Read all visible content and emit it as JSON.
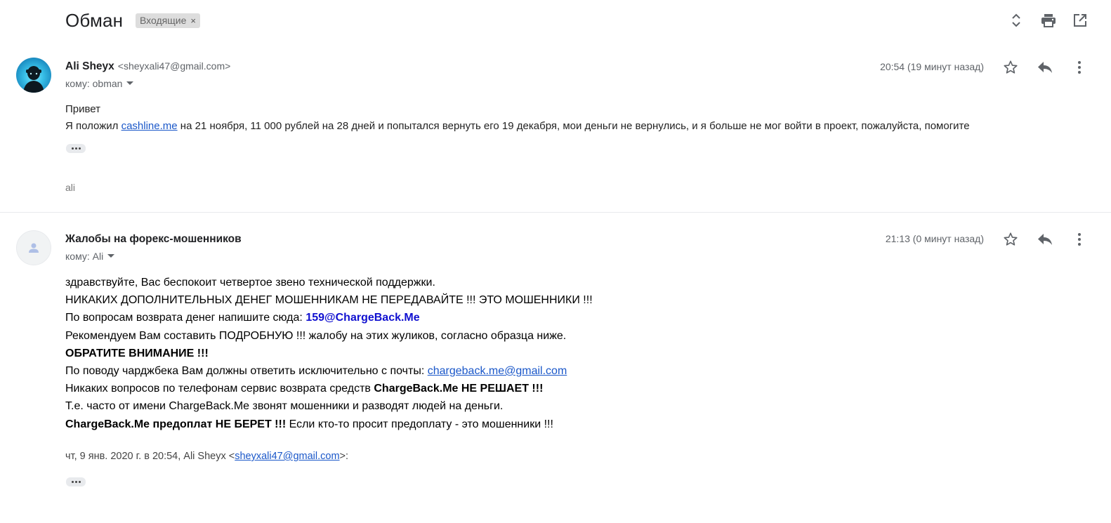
{
  "thread": {
    "subject": "Обман",
    "label": "Входящие",
    "label_remove": "×"
  },
  "toolbar_icons": [
    "expand-collapse-icon",
    "print-icon",
    "open-new-window-icon"
  ],
  "messages": [
    {
      "sender_name": "Ali Sheyx",
      "sender_email": "<sheyxali47@gmail.com>",
      "to": "кому: obman",
      "time": "20:54 (19 минут назад)",
      "greeting": "Привет",
      "text_before_link": "Я положил ",
      "link_text": "cashline.me",
      "text_after_link": " на 21 ноября, 11 000 рублей на 28 дней и попытался вернуть его 19 декабря, мои деньги не вернулись, и я больше не мог войти в проект, пожалуйста, помогите",
      "signature": "ali"
    },
    {
      "sender_name": "Жалобы на форекс-мошенников",
      "to": "кому: Ali",
      "time": "21:13 (0 минут назад)",
      "lines": {
        "l1": "здравствуйте, Вас беспокоит четвертое звено технической поддержки.",
        "l2": "НИКАКИХ ДОПОЛНИТЕЛЬНЫХ ДЕНЕГ МОШЕННИКАМ НЕ ПЕРЕДАВАЙТЕ !!! ЭТО МОШЕННИКИ !!!",
        "l3_text": "По вопросам возврата денег напишите сюда: ",
        "l3_email": "159@ChargeBack.Me",
        "l4": "Рекомендуем Вам составить ПОДРОБНУЮ !!! жалобу на этих жуликов, согласно образца ниже.",
        "l5": "ОБРАТИТЕ ВНИМАНИЕ !!!",
        "l6_text": "По поводу чарджбека Вам должны ответить исключительно с почты: ",
        "l6_link": "chargeback.me@gmail.com",
        "l7_text": "Никаких вопросов по телефонам сервис возврата средств ",
        "l7_bold": "ChargeBack.Me НЕ РЕШАЕТ !!!",
        "l8": "Т.е. часто от имени ChargeBack.Me звонят мошенники и разводят людей на деньги.",
        "l9_bold": "ChargeBack.Me предоплат НЕ БЕРЕТ !!!",
        "l9_text": " Если кто-то просит предоплату - это мошенники !!!"
      },
      "quote_prefix": "чт, 9 янв. 2020 г. в 20:54, Ali Sheyx <",
      "quote_link": "sheyxali47@gmail.com",
      "quote_suffix": ">:"
    }
  ],
  "colors": {
    "link": "#1a57c9",
    "email_highlight": "#1010d0",
    "label_chip": "#dddddd",
    "divider": "#e8eaed"
  }
}
